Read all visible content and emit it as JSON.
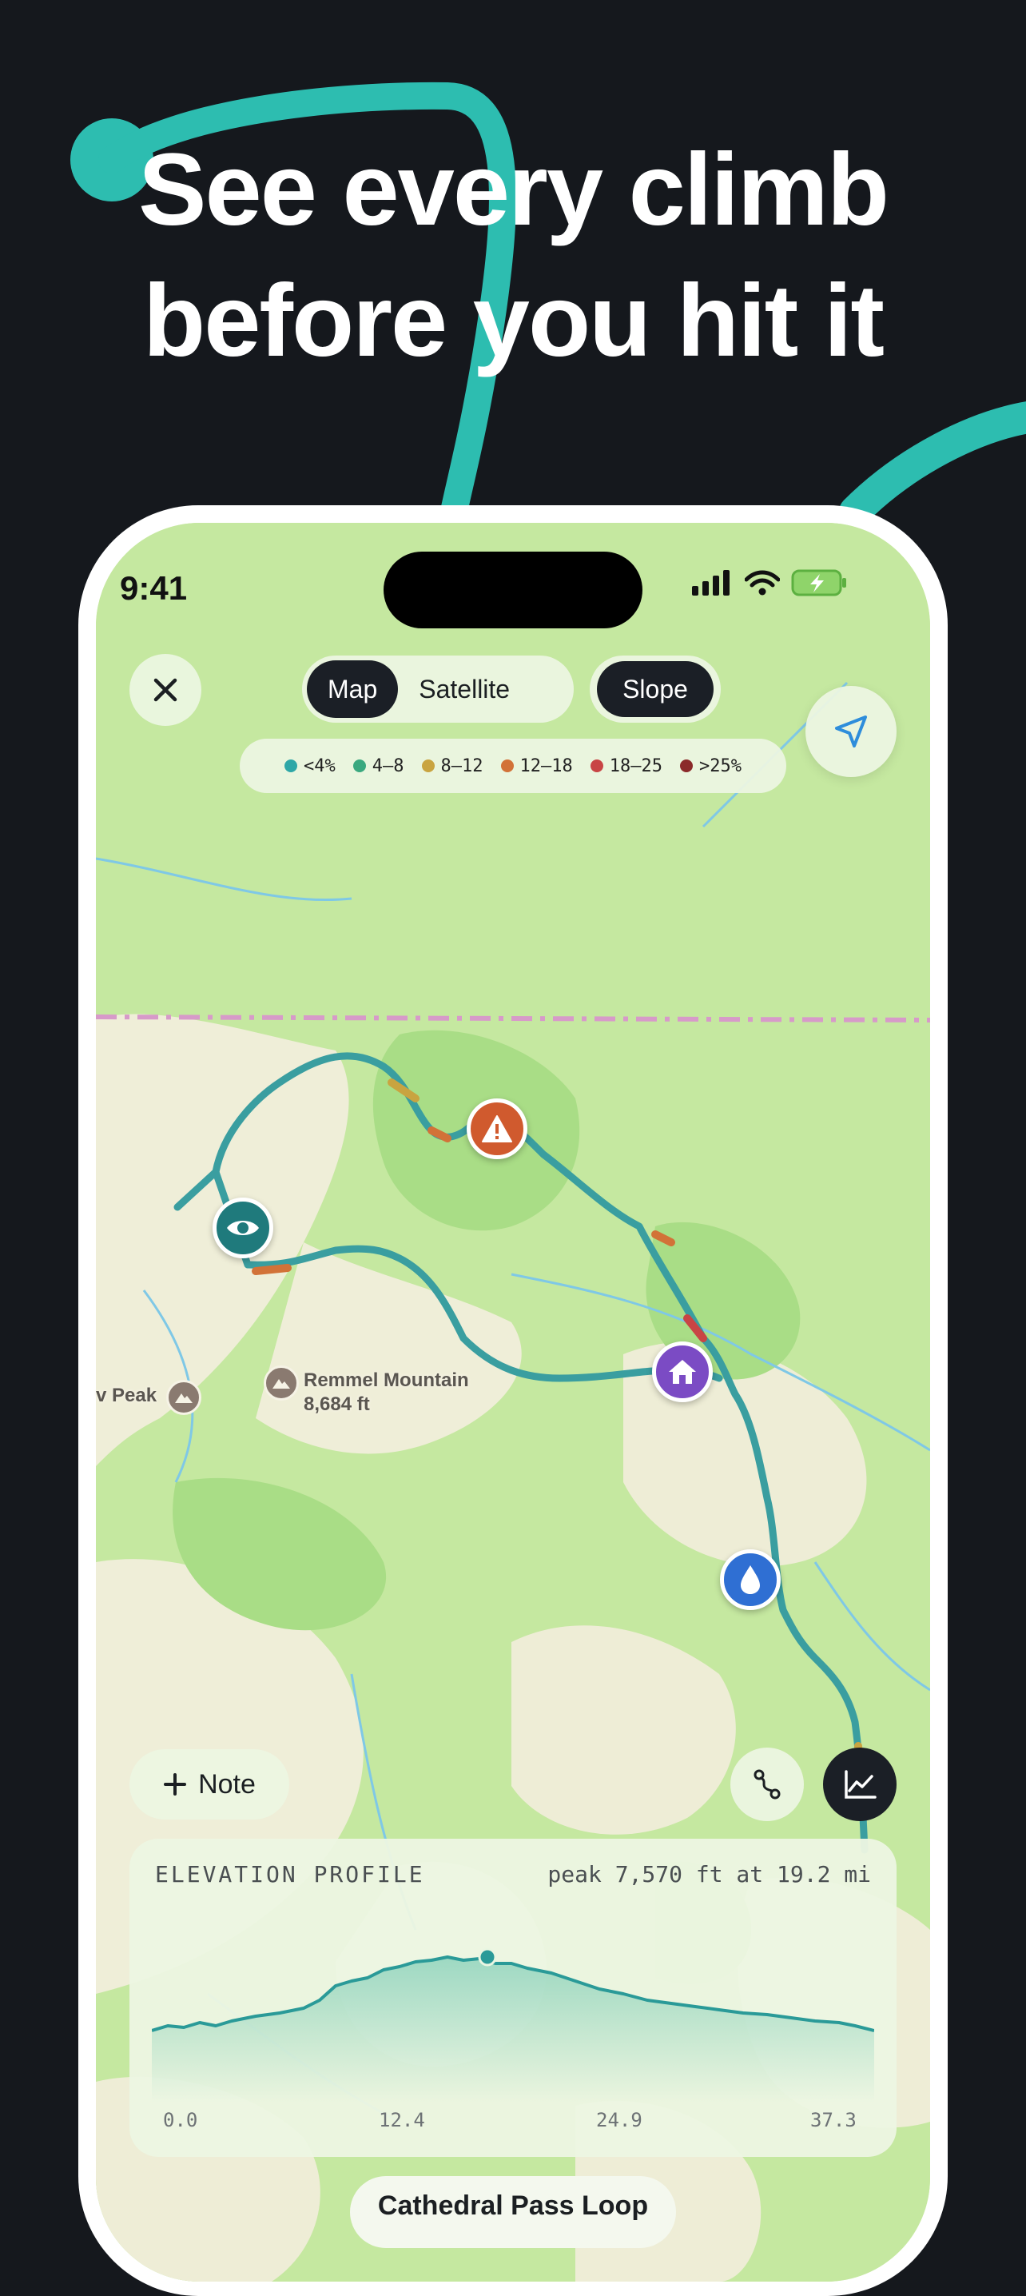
{
  "headline": {
    "line1": "See every climb",
    "line2": "before you hit it"
  },
  "status_bar": {
    "time": "9:41"
  },
  "map_controls": {
    "close_icon": "close-icon",
    "view_modes": [
      "Map",
      "Satellite"
    ],
    "active_view": "Map",
    "overlay_label": "Slope",
    "locate_icon": "navigation-arrow-icon"
  },
  "legend": [
    {
      "label": "<4%",
      "color": "#2ea7a7"
    },
    {
      "label": "4–8",
      "color": "#3aa87f"
    },
    {
      "label": "8–12",
      "color": "#c9a440"
    },
    {
      "label": "12–18",
      "color": "#d27238"
    },
    {
      "label": "18–25",
      "color": "#c84545"
    },
    {
      "label": ">25%",
      "color": "#8b2a2a"
    }
  ],
  "map_labels": {
    "peak_left": "v Peak",
    "remmel_name": "Remmel Mountain",
    "remmel_elev": "8,684 ft"
  },
  "markers": {
    "viewpoint": "eye-icon",
    "hazard": "warning-icon",
    "shelter": "home-icon",
    "water": "water-drop-icon"
  },
  "actions": {
    "note_label": "Note"
  },
  "elevation_profile": {
    "title": "ELEVATION PROFILE",
    "peak_text": "peak 7,570 ft at 19.2 mi",
    "ticks": [
      "0.0",
      "12.4",
      "24.9",
      "37.3"
    ]
  },
  "route": {
    "name": "Cathedral Pass Loop"
  }
}
